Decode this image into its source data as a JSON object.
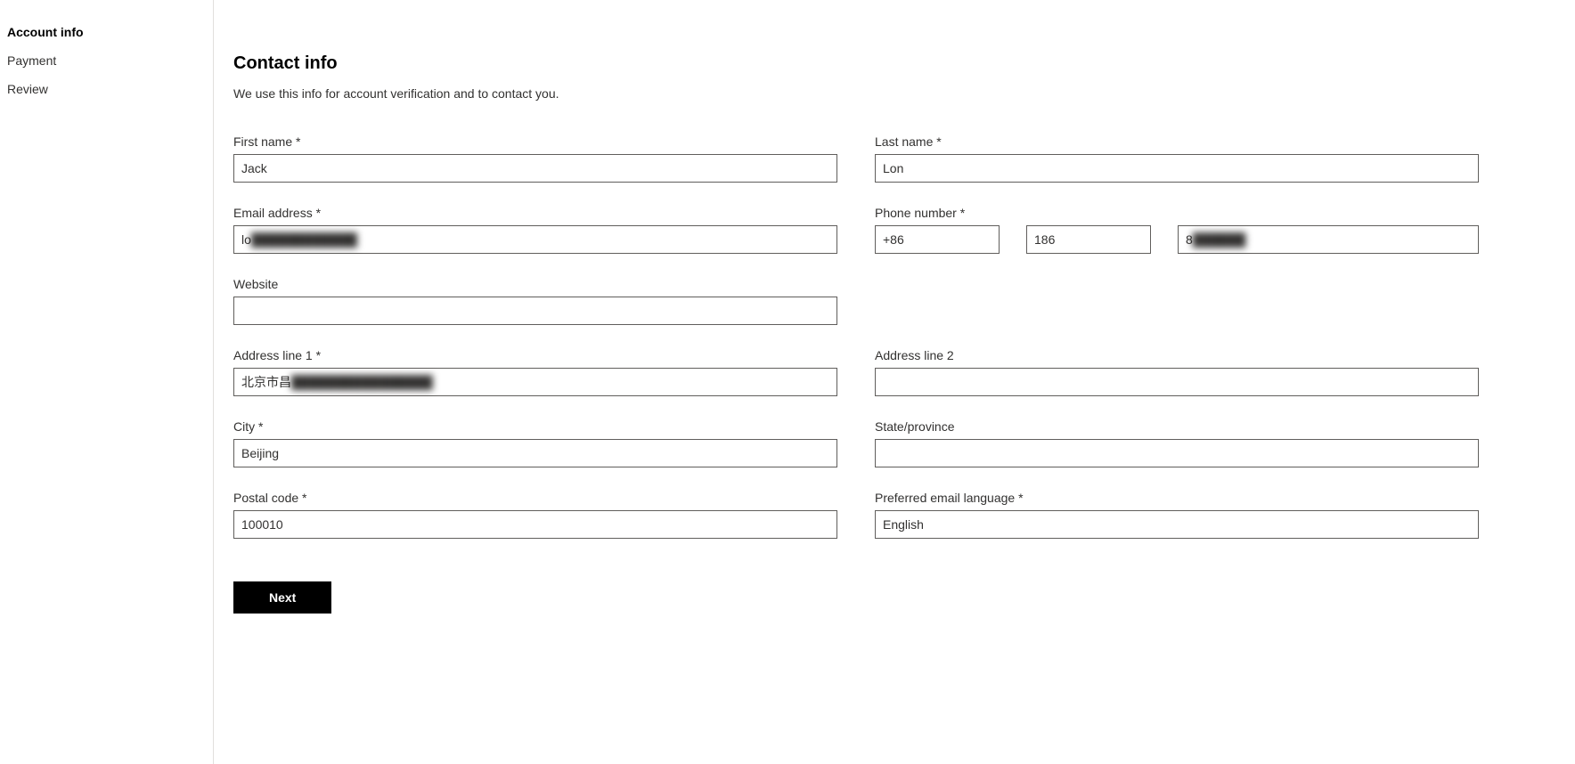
{
  "sidebar": {
    "items": [
      {
        "label": "Account info",
        "active": true
      },
      {
        "label": "Payment",
        "active": false
      },
      {
        "label": "Review",
        "active": false
      }
    ]
  },
  "section": {
    "title": "Contact info",
    "description": "We use this info for account verification and to contact you."
  },
  "labels": {
    "first_name": "First name *",
    "last_name": "Last name *",
    "email": "Email address *",
    "phone": "Phone number *",
    "website": "Website",
    "address1": "Address line 1 *",
    "address2": "Address line 2",
    "city": "City *",
    "state": "State/province",
    "postal": "Postal code *",
    "preferred_lang": "Preferred email language *"
  },
  "values": {
    "first_name": "Jack",
    "last_name": "Lon",
    "email_visible": "lo",
    "email_blurred": "████████████",
    "phone_country": "+86",
    "phone_prefix": "186",
    "phone_rest_visible": "8",
    "phone_rest_blurred": "██████",
    "website": "",
    "address1_visible": "北京市昌",
    "address1_blurred": "████████████████",
    "address2": "",
    "city": "Beijing",
    "state": "",
    "postal": "100010",
    "preferred_lang": "English"
  },
  "buttons": {
    "next": "Next"
  }
}
